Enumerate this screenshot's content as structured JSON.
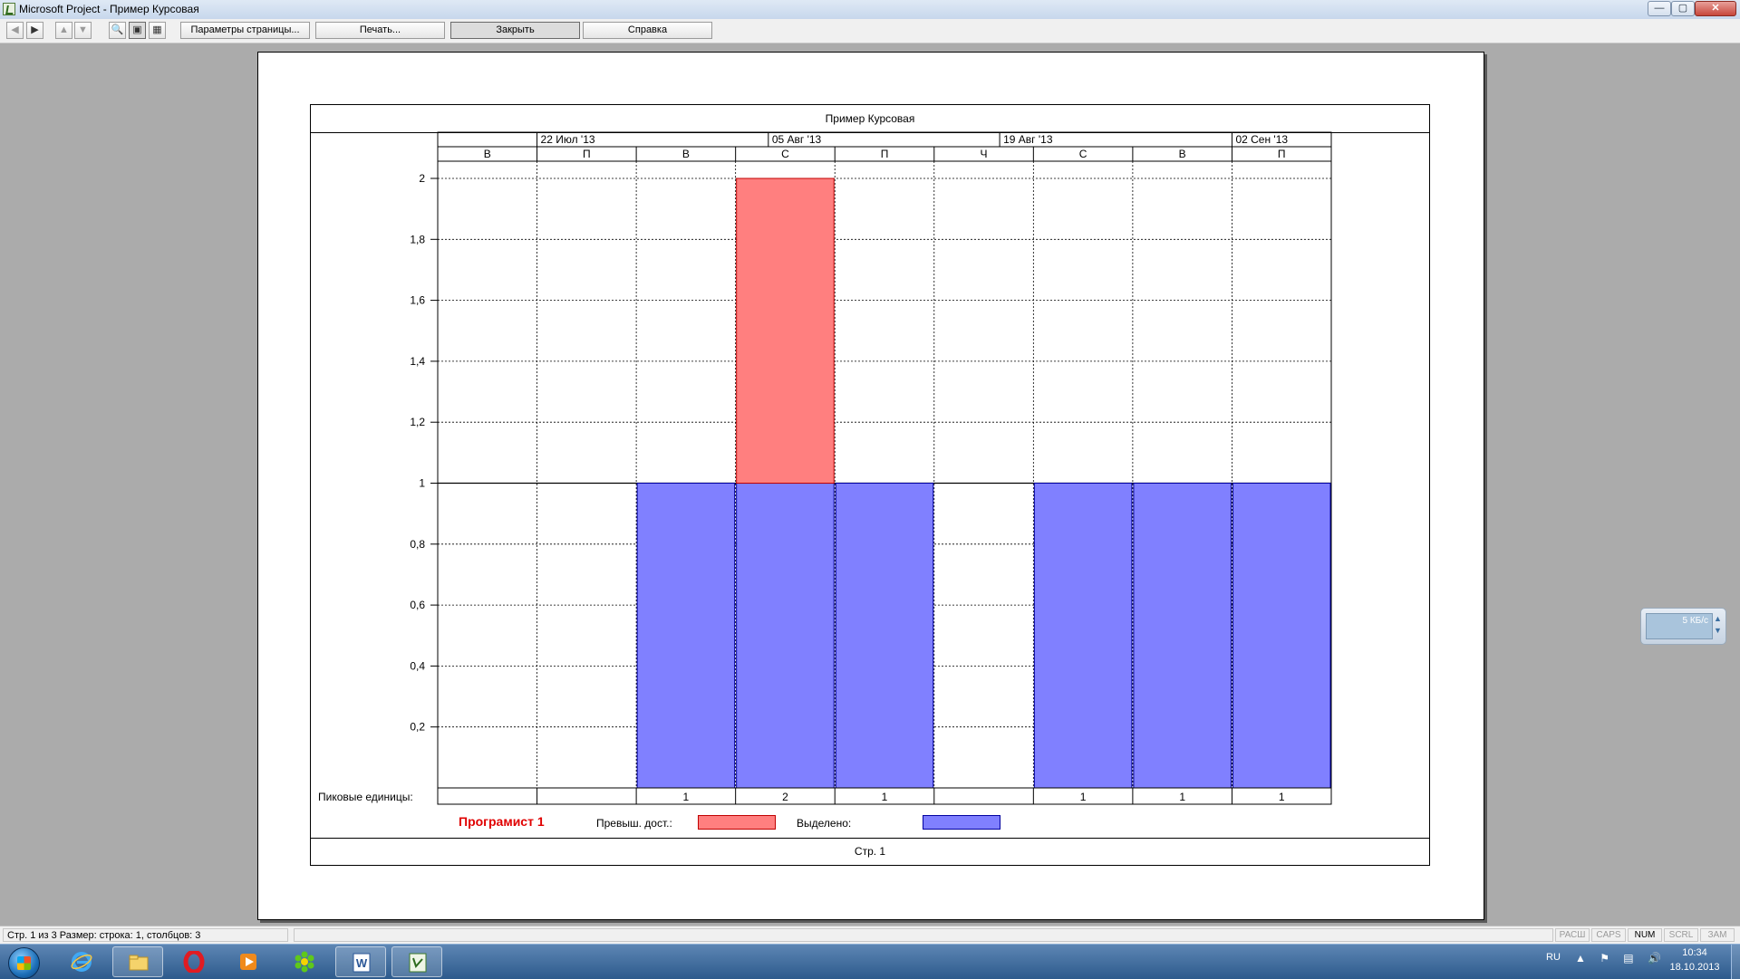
{
  "window": {
    "title": "Microsoft Project - Пример Курсовая",
    "min_glyph": "—",
    "max_glyph": "▢",
    "close_glyph": "✕"
  },
  "toolbar": {
    "page_setup": "Параметры страницы...",
    "print": "Печать...",
    "close": "Закрыть",
    "help": "Справка",
    "prev_glyph": "◀",
    "next_glyph": "▶",
    "up_glyph": "▲",
    "down_glyph": "▼",
    "zoom_glyph": "🔍",
    "one_page_glyph": "▣",
    "multi_page_glyph": "▦"
  },
  "report": {
    "title": "Пример Курсовая",
    "page_number": "Стр. 1",
    "peak_label": "Пиковые единицы:",
    "resource_name": "Програмист 1",
    "overallocated_label": "Превыш. дост.:",
    "allocated_label": "Выделено:"
  },
  "chart_data": {
    "type": "bar",
    "timescale_top": [
      "22 Июл '13",
      "05 Авг '13",
      "19 Авг '13",
      "02 Сен '13"
    ],
    "categories": [
      "В",
      "П",
      "В",
      "С",
      "П",
      "Ч",
      "С",
      "В",
      "П"
    ],
    "series": [
      {
        "name": "Выделено",
        "values": [
          0,
          0,
          1,
          1,
          1,
          0,
          1,
          1,
          1
        ]
      },
      {
        "name": "Превыш. дост.",
        "values": [
          0,
          0,
          0,
          1,
          0,
          0,
          0,
          0,
          0
        ]
      }
    ],
    "peak_units": [
      "",
      "",
      "1",
      "2",
      "1",
      "",
      "1",
      "1",
      "1"
    ],
    "y_ticks": [
      "0,2",
      "0,4",
      "0,6",
      "0,8",
      "1",
      "1,2",
      "1,4",
      "1,6",
      "1,8",
      "2"
    ],
    "ylim": [
      0,
      2
    ],
    "grid": true,
    "colors": {
      "allocated": "#8080ff",
      "allocated_border": "#0000a0",
      "overallocated": "#ff7f7f",
      "overallocated_border": "#c00000"
    }
  },
  "network_widget": {
    "rate": "5 КБ/с",
    "up_glyph": "▲",
    "down_glyph": "▼"
  },
  "statusbar": {
    "text": "Стр. 1 из 3   Размер: строка: 1, столбцов: 3",
    "indicators": [
      {
        "label": "РАСШ",
        "on": false
      },
      {
        "label": "CAPS",
        "on": false
      },
      {
        "label": "NUM",
        "on": true
      },
      {
        "label": "SCRL",
        "on": false
      },
      {
        "label": "ЗАМ",
        "on": false
      }
    ]
  },
  "taskbar": {
    "language": "RU",
    "tray_glyphs": "▲ ⚑ ▤ 🔊",
    "time": "10:34",
    "date": "18.10.2013",
    "apps": [
      "internet-explorer",
      "file-explorer",
      "opera",
      "media-player",
      "icq",
      "microsoft-word",
      "microsoft-project"
    ]
  }
}
